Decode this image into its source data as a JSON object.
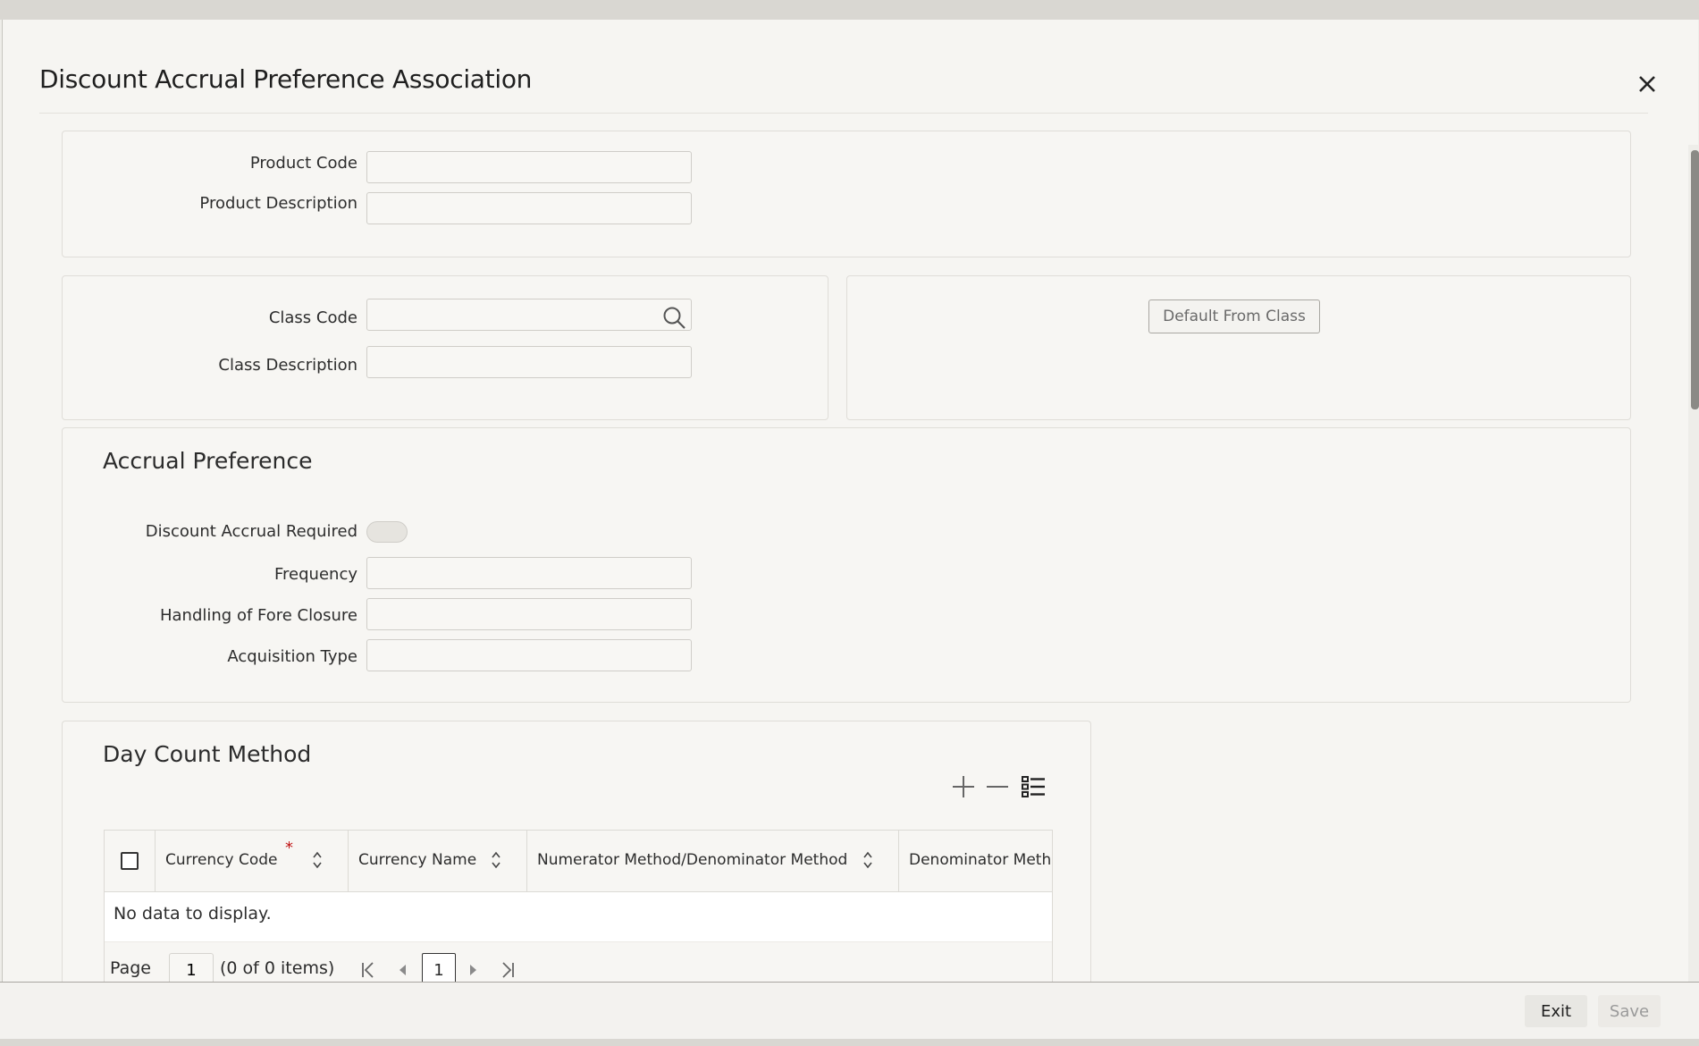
{
  "window": {
    "title": "Discount Accrual Preference Association"
  },
  "product": {
    "code_label": "Product Code",
    "code_value": "",
    "description_label": "Product Description",
    "description_value": ""
  },
  "class": {
    "code_label": "Class Code",
    "code_value": "",
    "description_label": "Class Description",
    "description_value": "",
    "default_button": "Default From Class"
  },
  "accrual": {
    "section_title": "Accrual Preference",
    "discount_required_label": "Discount Accrual Required",
    "discount_required_on": false,
    "frequency_label": "Frequency",
    "frequency_value": "",
    "fore_closure_label": "Handling of Fore Closure",
    "fore_closure_value": "",
    "acquisition_label": "Acquisition Type",
    "acquisition_value": ""
  },
  "day_count": {
    "section_title": "Day Count Method",
    "columns": [
      {
        "label": "Currency Code",
        "required_marker": "*"
      },
      {
        "label": "Currency Name"
      },
      {
        "label": "Numerator Method/Denominator Method"
      },
      {
        "label": "Denominator Metho"
      }
    ],
    "empty_text": "No data to display.",
    "pager": {
      "page_label": "Page",
      "page_value": "1",
      "items_text": "(0 of 0 items)",
      "current_page": "1"
    }
  },
  "footer": {
    "exit_label": "Exit",
    "save_label": "Save"
  },
  "icons": {
    "close": "close-icon",
    "search": "search-icon",
    "add": "plus-icon",
    "remove": "minus-icon",
    "columns": "list-icon"
  }
}
